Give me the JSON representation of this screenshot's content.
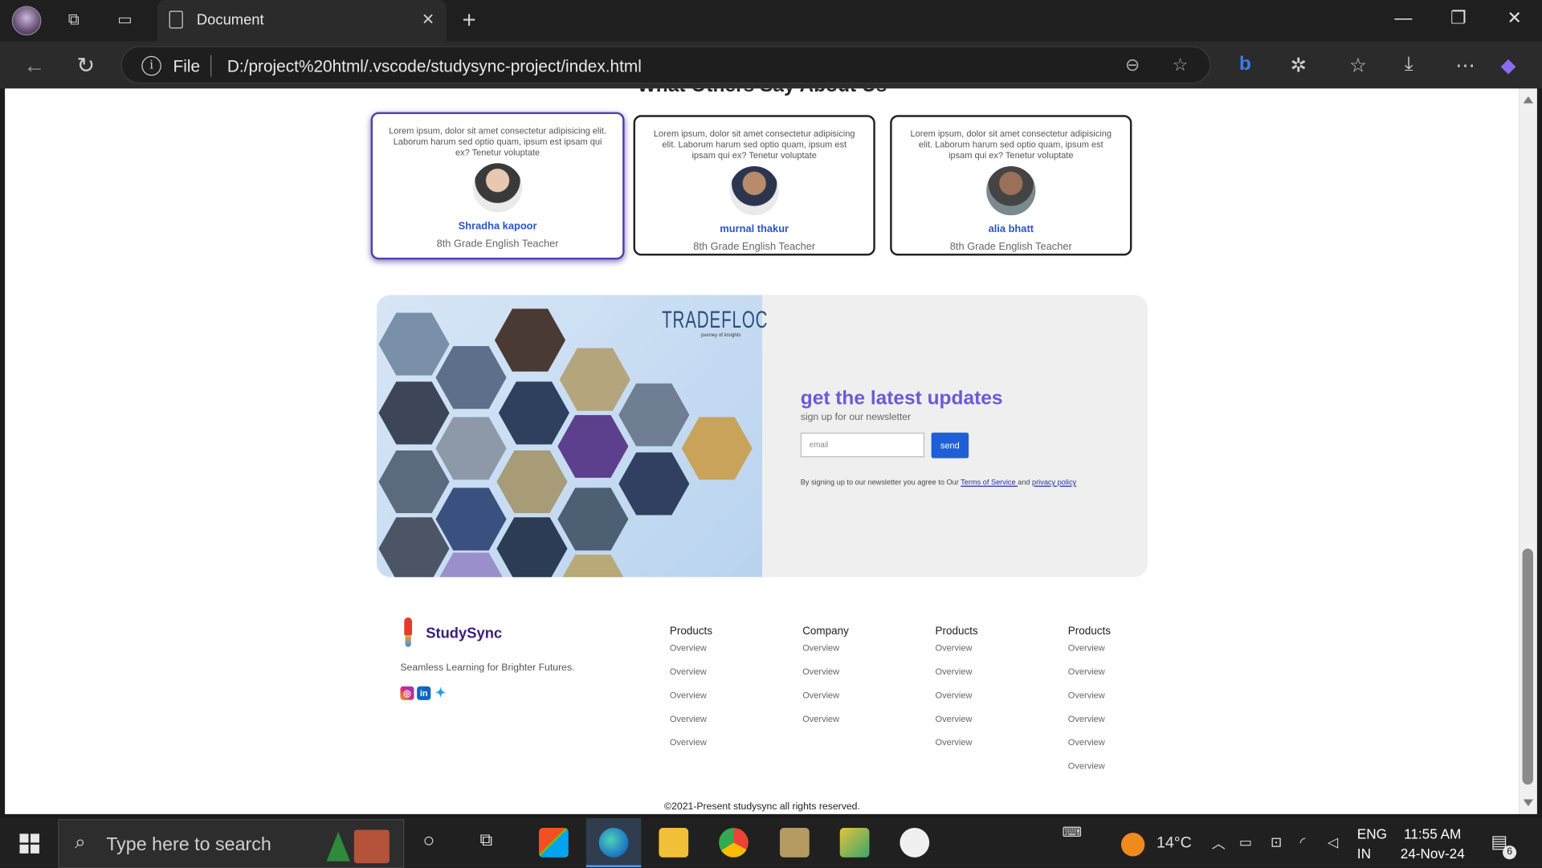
{
  "browser": {
    "tab_title": "Document",
    "url_scheme": "File",
    "url": "D:/project%20html/.vscode/studysync-project/index.html"
  },
  "page": {
    "section_heading": "What Others Say About Us",
    "testimonials": [
      {
        "text": "Lorem ipsum, dolor sit amet consectetur adipisicing elit. Laborum harum sed optio quam, ipsum est ipsam qui ex? Tenetur voluptate",
        "name": "Shradha kapoor",
        "role": "8th Grade English Teacher"
      },
      {
        "text": "Lorem ipsum, dolor sit amet consectetur adipisicing elit. Laborum harum sed optio quam, ipsum est ipsam qui ex? Tenetur voluptate",
        "name": "murnal thakur",
        "role": "8th Grade English Teacher"
      },
      {
        "text": "Lorem ipsum, dolor sit amet consectetur adipisicing elit. Laborum harum sed optio quam, ipsum est ipsam qui ex? Tenetur voluptate",
        "name": "alia bhatt",
        "role": "8th Grade English Teacher"
      }
    ],
    "newsletter": {
      "brand_logo": "TRADEFLOC",
      "brand_logo_tagline": "journey of insights",
      "title": "get the latest updates",
      "subtitle": "sign up for our newsletter",
      "email_placeholder": "email",
      "send_label": "send",
      "legal_prefix": "By signing up to our newsletter you agree to Our ",
      "terms_label": "Terms of Service ",
      "legal_and": "and ",
      "privacy_label": "privacy policy"
    },
    "footer": {
      "brand": "StudySync",
      "tagline": "Seamless Learning for Brighter Futures.",
      "columns": [
        {
          "title": "Products",
          "links": [
            "Overview",
            "Overview",
            "Overview",
            "Overview",
            "Overview"
          ]
        },
        {
          "title": "Company",
          "links": [
            "Overview",
            "Overview",
            "Overview",
            "Overview"
          ]
        },
        {
          "title": "Products",
          "links": [
            "Overview",
            "Overview",
            "Overview",
            "Overview",
            "Overview"
          ]
        },
        {
          "title": "Products",
          "links": [
            "Overview",
            "Overview",
            "Overview",
            "Overview",
            "Overview",
            "Overview"
          ]
        }
      ],
      "copyright": "©2021-Present studysync all rights reserved."
    }
  },
  "taskbar": {
    "search_placeholder": "Type here to search",
    "weather": "14°C",
    "lang_line1": "ENG",
    "lang_line2": "IN",
    "time": "11:55 AM",
    "date": "24-Nov-24",
    "notification_count": "6"
  },
  "colors": {
    "accent_blue": "#2a55c9",
    "newsletter_title": "#6a5ad6",
    "send_button": "#1f5fd6",
    "brand_purple": "#3b1d78"
  }
}
